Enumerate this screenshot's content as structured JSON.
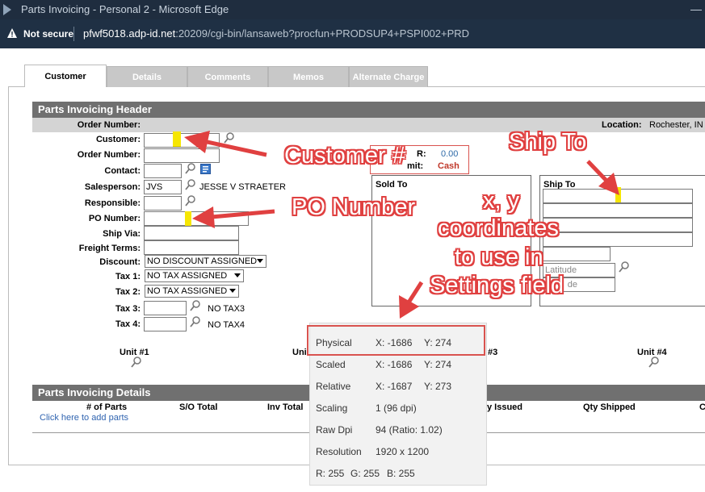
{
  "window": {
    "title": "Parts Invoicing - Personal 2 - Microsoft Edge",
    "minimize_glyph": "—"
  },
  "addressbar": {
    "security": "Not secure",
    "url_host": "pfwf5018.adp-id.net",
    "url_rest": ":20209/cgi-bin/lansaweb?procfun+PRODSUP4+PSPI002+PRD"
  },
  "tabs": [
    "Customer",
    "Details",
    "Comments",
    "Memos",
    "Alternate Charge"
  ],
  "header": {
    "title": "Parts Invoicing Header",
    "order_number_label": "Order Number:",
    "location_label": "Location:",
    "location_value": "Rochester, IN"
  },
  "form": {
    "customer_label": "Customer:",
    "order_number_label": "Order Number:",
    "contact_label": "Contact:",
    "salesperson_label": "Salesperson:",
    "salesperson_value": "JVS",
    "salesperson_name": "JESSE V STRAETER",
    "responsible_label": "Responsible:",
    "po_number_label": "PO Number:",
    "ship_via_label": "Ship Via:",
    "freight_terms_label": "Freight Terms:",
    "discount_label": "Discount:",
    "discount_value": "NO DISCOUNT ASSIGNED",
    "tax1_label": "Tax 1:",
    "tax1_value": "NO TAX ASSIGNED",
    "tax2_label": "Tax 2:",
    "tax2_value": "NO TAX ASSIGNED",
    "tax3_label": "Tax 3:",
    "tax3_note": "NO TAX3",
    "tax4_label": "Tax 4:",
    "tax4_note": "NO TAX4"
  },
  "credit": {
    "ar_label_partial": "R:",
    "ar_value": "0.00",
    "limit_label_partial": "mit:",
    "limit_value": "Cash"
  },
  "sold_to": {
    "label": "Sold To"
  },
  "ship_to": {
    "label": "Ship To",
    "latitude_placeholder_partial": "Latitude",
    "longitude_placeholder_partial": "de"
  },
  "units": [
    "Unit #1",
    "Uni",
    "#3",
    "Unit #4"
  ],
  "details": {
    "title": "Parts Invoicing Details",
    "columns": [
      "# of Parts",
      "S/O Total",
      "Inv Total",
      "y Issued",
      "Qty Shipped",
      "C"
    ],
    "add_parts_link": "Click here to add parts"
  },
  "annotations": {
    "customer": "Customer #",
    "ship_to": "Ship To",
    "po_number": "PO Number",
    "coords_line1": "x, y",
    "coords_line2": "coordinates",
    "coords_line3": "to use in",
    "coords_line4": "Settings field",
    "color": "#e04040"
  },
  "coords_popup": {
    "rows": [
      {
        "label": "Physical",
        "x": "X: -1686",
        "y": "Y: 274"
      },
      {
        "label": "Scaled",
        "x": "X: -1686",
        "y": "Y: 274"
      },
      {
        "label": "Relative",
        "x": "X: -1687",
        "y": "Y: 273"
      },
      {
        "label": "Scaling",
        "x": "1 (96 dpi)",
        "y": ""
      },
      {
        "label": "Raw Dpi",
        "x": "94  (Ratio: 1.02)",
        "y": ""
      },
      {
        "label": "Resolution",
        "x": "1920 x 1200",
        "y": ""
      }
    ],
    "rgb_r": "R: 255",
    "rgb_g": "G: 255",
    "rgb_b": "B: 255"
  },
  "icons": [
    "play-icon",
    "warning-icon",
    "magnifier-icon",
    "contact-card-icon",
    "arrow-icon"
  ]
}
